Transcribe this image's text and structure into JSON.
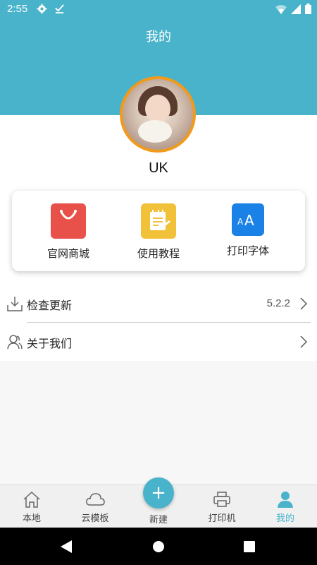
{
  "status_bar": {
    "time": "2:55",
    "icons": [
      "gear-icon",
      "download-check-icon",
      "wifi-icon",
      "signal-icon",
      "battery-icon"
    ]
  },
  "header": {
    "title": "我的",
    "bg_color": "#49b3cb"
  },
  "profile": {
    "username": "UK",
    "avatar_ring_color": "#f29a1a"
  },
  "shortcuts": [
    {
      "label": "官网商城",
      "icon": "shopping-bag-icon",
      "color": "#e8504a"
    },
    {
      "label": "使用教程",
      "icon": "notepad-icon",
      "color": "#f2c13a"
    },
    {
      "label": "打印字体",
      "icon": "font-size-icon",
      "color": "#1a82e6"
    }
  ],
  "settings": {
    "check_update": {
      "label": "检查更新",
      "version": "5.2.2",
      "icon": "download-icon"
    },
    "about_us": {
      "label": "关于我们",
      "icon": "users-icon"
    }
  },
  "bottom_nav": {
    "items": [
      {
        "label": "本地",
        "icon": "home-icon"
      },
      {
        "label": "云模板",
        "icon": "cloud-icon"
      },
      {
        "label": "新建",
        "icon": "plus-icon"
      },
      {
        "label": "打印机",
        "icon": "printer-icon"
      },
      {
        "label": "我的",
        "icon": "person-icon",
        "active": true
      }
    ],
    "plus_symbol": "+",
    "accent_color": "#49b3cb"
  },
  "system_nav": {
    "icons": [
      "back-icon",
      "home-circle-icon",
      "recents-icon"
    ]
  }
}
